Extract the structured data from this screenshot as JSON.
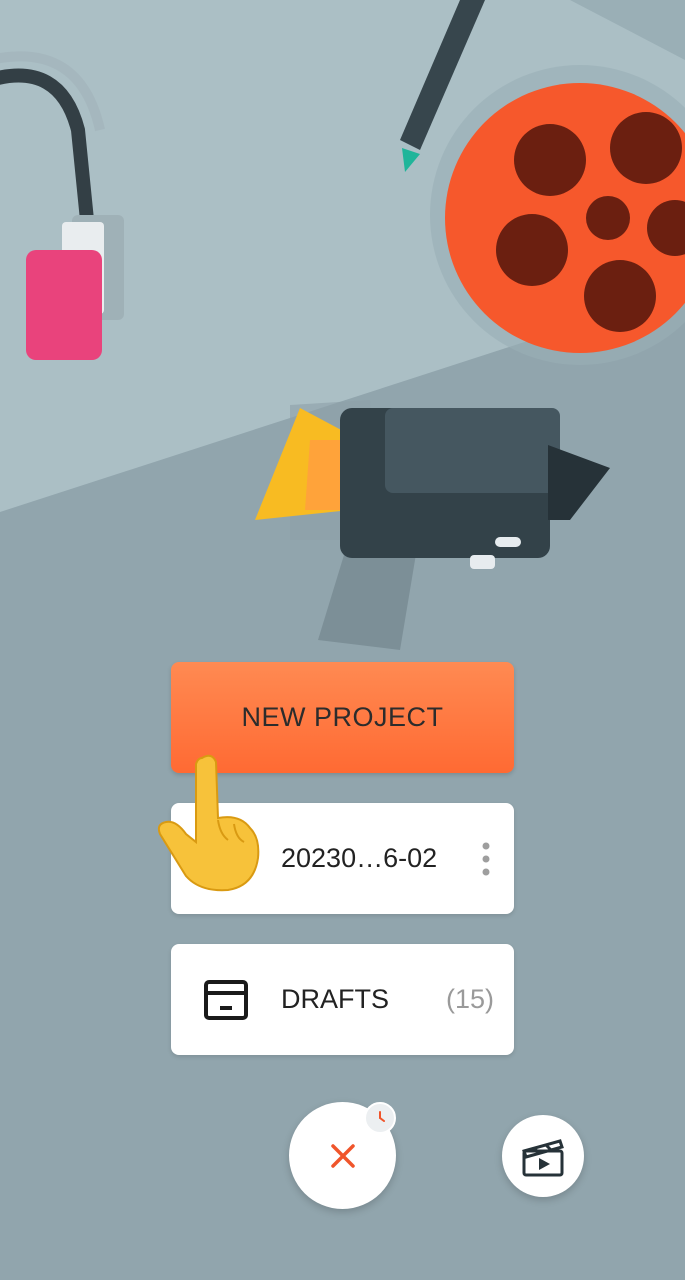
{
  "new_project": {
    "label": "NEW PROJECT"
  },
  "recent": {
    "name": "20230…6-02"
  },
  "drafts": {
    "label": "DRAFTS",
    "count": "(15)"
  },
  "icons": {
    "close": "close-icon",
    "clock": "clock-icon",
    "clapperboard": "clapperboard-icon",
    "drafts": "archive-box-icon",
    "menu": "more-vertical-icon",
    "pointer": "pointing-hand-icon"
  },
  "colors": {
    "background": "#91a5ad",
    "accent": "#ff6a33",
    "close_x": "#f0552b"
  }
}
